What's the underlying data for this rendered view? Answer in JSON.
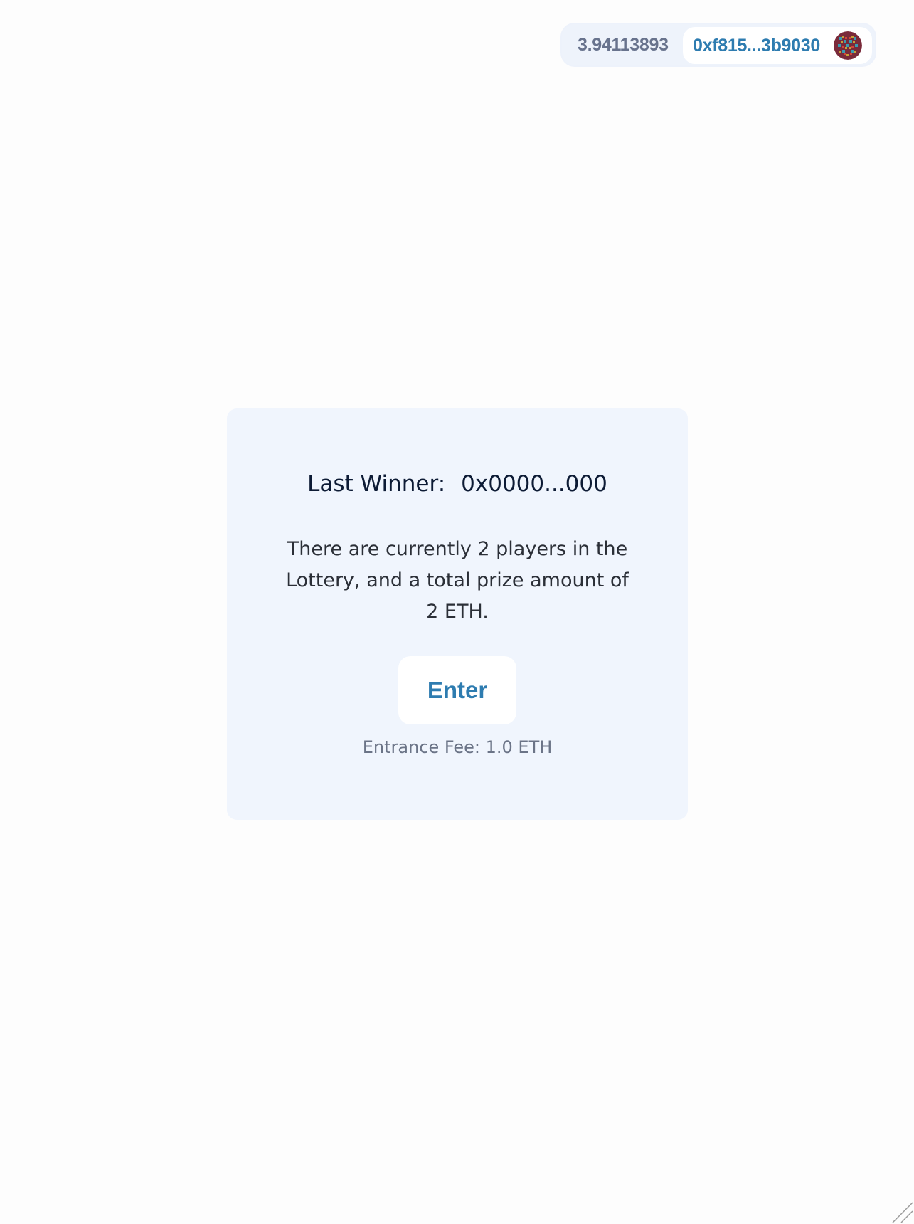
{
  "wallet": {
    "balance": "3.94113893",
    "address": "0xf815...3b9030",
    "avatar_icon": "identicon-avatar"
  },
  "lottery": {
    "last_winner_label": "Last Winner:",
    "last_winner_address": "0x0000...000",
    "players_text": "There are currently 2 players in the Lottery, and a total prize amount of 2 ETH.",
    "enter_button_label": "Enter",
    "entrance_fee_text": "Entrance Fee: 1.0 ETH"
  },
  "colors": {
    "accent": "#2e7cb0",
    "card_background": "#f0f5fd",
    "muted_text": "#6b7487"
  }
}
